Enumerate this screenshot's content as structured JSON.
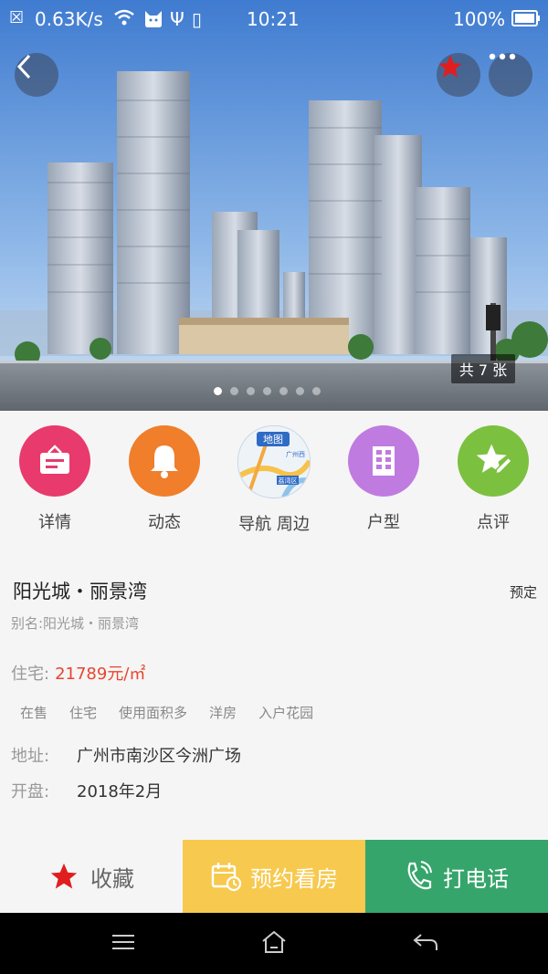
{
  "status_bar": {
    "speed": "0.63K/s",
    "time": "10:21",
    "battery": "100%"
  },
  "hero": {
    "photo_count": "共 7 张",
    "dots_total": 7,
    "active_dot": 1
  },
  "quick_actions": [
    {
      "label": "详情",
      "icon": "document-icon",
      "color": "#e83a6c"
    },
    {
      "label": "动态",
      "icon": "bell-icon",
      "color": "#f07e2a"
    },
    {
      "label": "导航 周边",
      "icon": "map-icon",
      "map_label": "地图",
      "map_text1": "广州西",
      "map_text2": "荔湾区"
    },
    {
      "label": "户型",
      "icon": "building-icon",
      "color": "#c07be0"
    },
    {
      "label": "点评",
      "icon": "star-pen-icon",
      "color": "#7cc040"
    }
  ],
  "property": {
    "name": "阳光城・丽景湾",
    "sale_status": "预定",
    "alias": "别名:阳光城・丽景湾",
    "price_label": "住宅:",
    "price": "21789元/㎡",
    "tags": [
      "在售",
      "住宅",
      "使用面积多",
      "洋房",
      "入户花园"
    ],
    "address_label": "地址:",
    "address": "广州市南沙区今洲广场",
    "opening_label": "开盘:",
    "opening": "2018年2月"
  },
  "bottom_actions": {
    "favorite": "收藏",
    "booking": "预约看房",
    "call": "打电话"
  },
  "colors": {
    "accent_red": "#e8452e",
    "booking_yellow": "#f7c94e",
    "call_green": "#36a56b"
  }
}
